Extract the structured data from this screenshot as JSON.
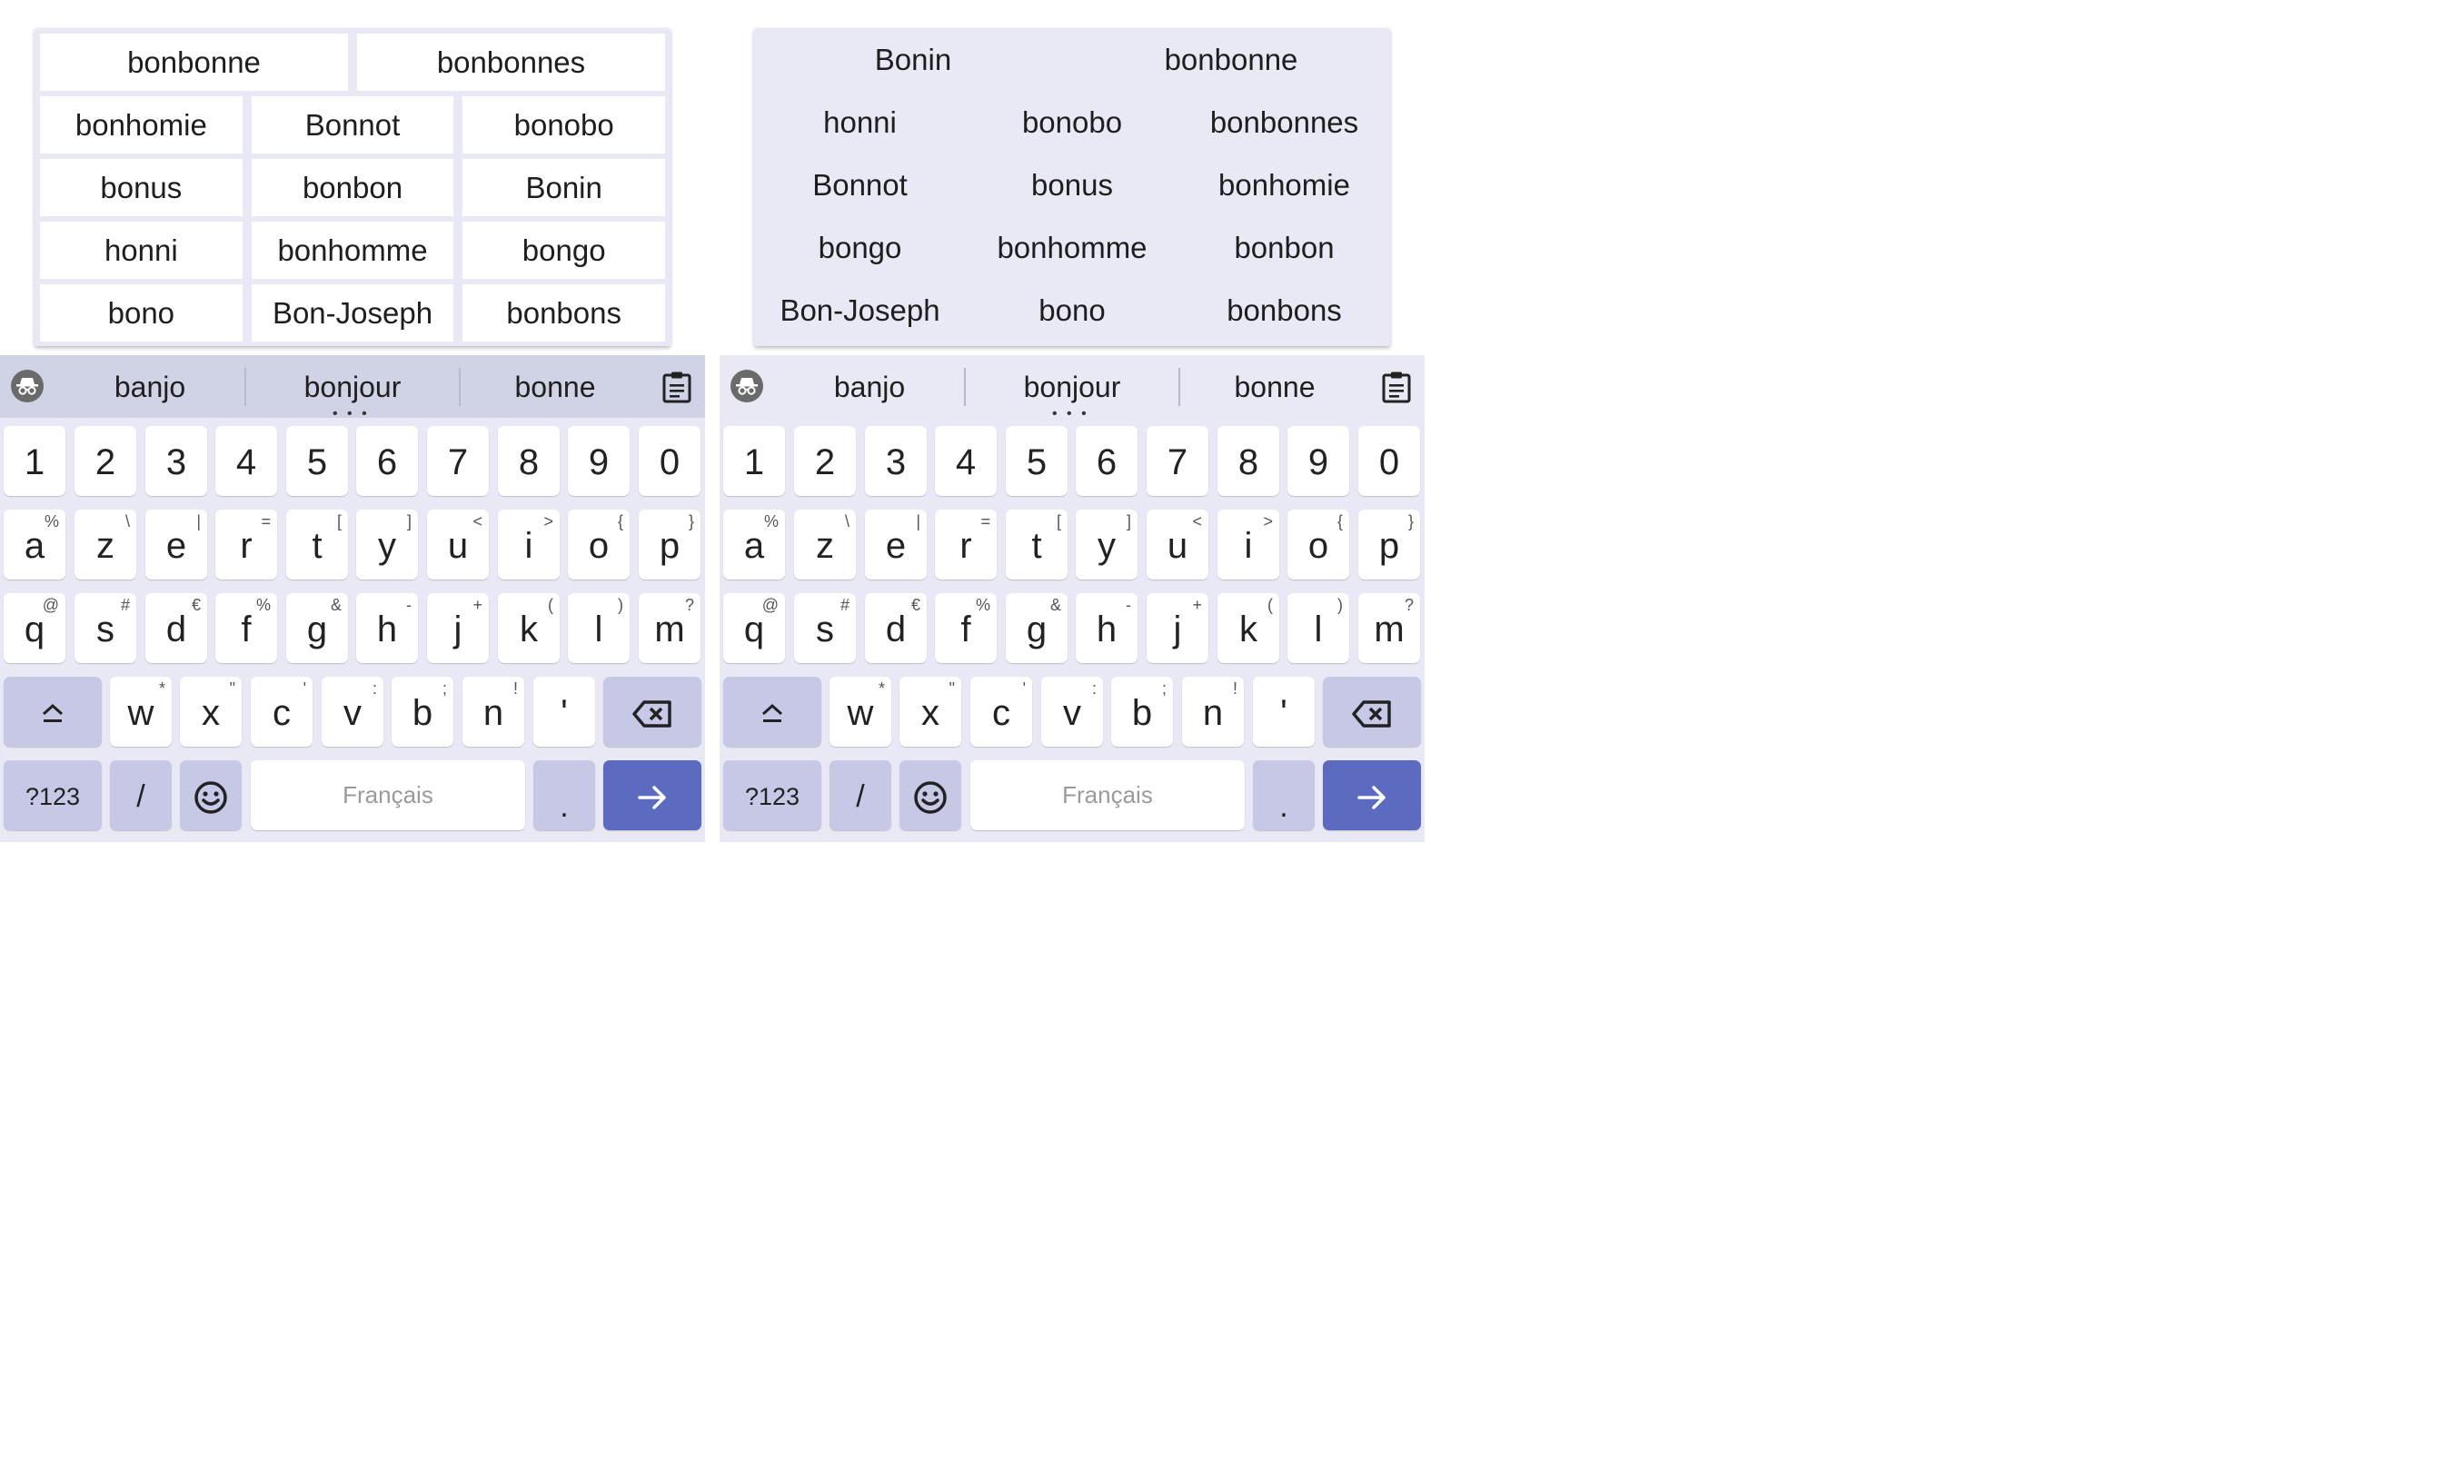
{
  "left_popup": {
    "rows": [
      [
        "bonbonne",
        "bonbonnes"
      ],
      [
        "bonhomie",
        "Bonnot",
        "bonobo"
      ],
      [
        "bonus",
        "bonbon",
        "Bonin"
      ],
      [
        "honni",
        "bonhomme",
        "bongo"
      ],
      [
        "bono",
        "Bon-Joseph",
        "bonbons"
      ]
    ]
  },
  "right_popup": {
    "rows": [
      [
        "Bonin",
        "bonbonne"
      ],
      [
        "honni",
        "bonobo",
        "bonbonnes"
      ],
      [
        "Bonnot",
        "bonus",
        "bonhomie"
      ],
      [
        "bongo",
        "bonhomme",
        "bonbon"
      ],
      [
        "Bon-Joseph",
        "bono",
        "bonbons"
      ]
    ]
  },
  "suggestion_strip": {
    "left": "banjo",
    "center": "bonjour",
    "right": "bonne",
    "more_indicator": "• • •",
    "incognito_icon": "incognito-icon",
    "clipboard_icon": "clipboard-icon"
  },
  "number_row": [
    "1",
    "2",
    "3",
    "4",
    "5",
    "6",
    "7",
    "8",
    "9",
    "0"
  ],
  "row1": {
    "keys": [
      "a",
      "z",
      "e",
      "r",
      "t",
      "y",
      "u",
      "i",
      "o",
      "p"
    ],
    "hints": [
      "%",
      "\\",
      "|",
      "=",
      "[",
      "]",
      "<",
      ">",
      "{",
      "}"
    ]
  },
  "row2": {
    "keys": [
      "q",
      "s",
      "d",
      "f",
      "g",
      "h",
      "j",
      "k",
      "l",
      "m"
    ],
    "hints": [
      "@",
      "#",
      "€",
      "%",
      "&",
      "-",
      "+",
      "(",
      ")",
      "?"
    ]
  },
  "row3": {
    "keys": [
      "w",
      "x",
      "c",
      "v",
      "b",
      "n",
      "'"
    ],
    "hints": [
      "*",
      "\"",
      "'",
      ":",
      ";",
      "!",
      ""
    ]
  },
  "bottom_row": {
    "symbols_label": "?123",
    "slash": "/",
    "space_label": "Français",
    "period": ".",
    "enter_icon": "arrow-right-icon",
    "emoji_icon": "emoji-icon"
  },
  "colors": {
    "keyboard_bg": "#e8e9f5",
    "strip_bg_left": "#d0d2e5",
    "function_key": "#c6c8e6",
    "accent": "#5c6bc0"
  }
}
